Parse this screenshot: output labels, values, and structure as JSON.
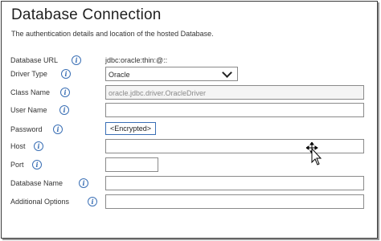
{
  "header": {
    "title": "Database Connection",
    "subtitle": "The authentication details and location of the hosted Database."
  },
  "fields": {
    "database_url": {
      "label": "Database URL",
      "value": "jdbc:oracle:thin:@::"
    },
    "driver_type": {
      "label": "Driver Type",
      "selected": "Oracle"
    },
    "class_name": {
      "label": "Class Name",
      "value": "oracle.jdbc.driver.OracleDriver"
    },
    "user_name": {
      "label": "User Name",
      "value": ""
    },
    "password": {
      "label": "Password",
      "button_label": "<Encrypted>"
    },
    "host": {
      "label": "Host",
      "value": ""
    },
    "port": {
      "label": "Port",
      "value": ""
    },
    "database_name": {
      "label": "Database Name",
      "value": ""
    },
    "additional_options": {
      "label": "Additional Options",
      "value": ""
    }
  },
  "icons": {
    "info": "info-icon",
    "cursor": "move-cursor-icon"
  },
  "colors": {
    "info_accent": "#3a6fb5",
    "border": "#8a8a8a"
  }
}
